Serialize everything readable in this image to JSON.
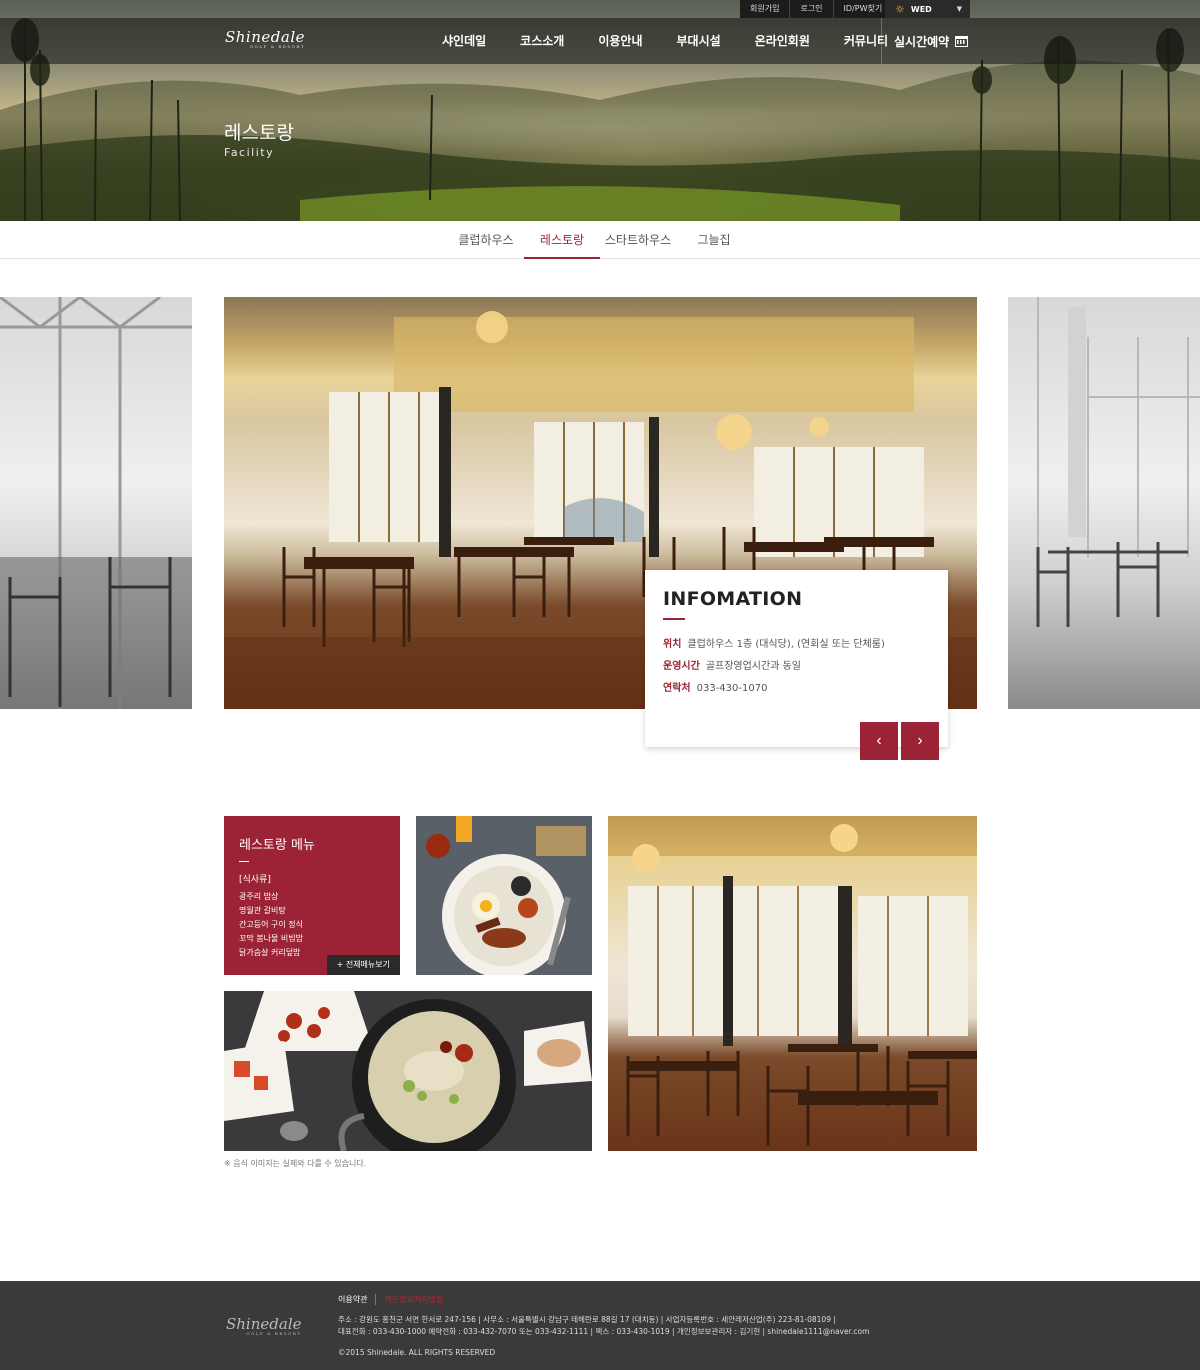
{
  "util_links": [
    "회원가입",
    "로그인",
    "ID/PW찾기"
  ],
  "weather": {
    "icon": "sun-icon",
    "day": "WED"
  },
  "brand": {
    "name": "Shinedale",
    "tagline": "GOLF & RESORT"
  },
  "nav": {
    "items": [
      "샤인데일",
      "코스소개",
      "이용안내",
      "부대시설",
      "온라인회원",
      "커뮤니티"
    ],
    "reserve": "실시간예약"
  },
  "hero": {
    "title": "레스토랑",
    "subtitle": "Facility"
  },
  "tabs": [
    {
      "label": "클럽하우스",
      "active": false
    },
    {
      "label": "레스토랑",
      "active": true
    },
    {
      "label": "스타트하우스",
      "active": false
    },
    {
      "label": "그늘집",
      "active": false
    }
  ],
  "info": {
    "title": "INFOMATION",
    "rows": [
      {
        "label": "위치",
        "value": "클럽하우스 1층 (대식당), (연회실 또는 단체룸)"
      },
      {
        "label": "운영시간",
        "value": "골프장영업시간과 동일"
      },
      {
        "label": "연락처",
        "value": "033-430-1070"
      }
    ],
    "prev": "‹",
    "next": "›"
  },
  "menu": {
    "title": "레스토랑 메뉴",
    "category": "[식사류]",
    "items": [
      "광주리 밥상",
      "명월관 갈비탕",
      "간고등어 구이 정식",
      "꼬막 봄나물 비빔밥",
      "닭가슴살 커리덮밥"
    ],
    "more": "+ 전체메뉴보기"
  },
  "note": "※ 음식 이미지는 실제와 다를 수 있습니다.",
  "footer": {
    "links": [
      "이용약관",
      "개인정보처리방침"
    ],
    "address_line1": "주소 : 강원도 홍천군 서면 한서로 247-156  |  사무소 : 서울특별시 강남구 테헤란로 88길 17 (대치동)  |  사업자등록번호 : 세안레저산업(주) 223-81-08109  |",
    "address_line2": "대표전화 : 033-430-1000 예약전화 : 033-432-7070 또는 033-432-1111  |  팩스 : 033-430-1019  |  개인정보보관리자 : 김기현  |  shinedale1111@naver.com",
    "copyright": "©2015 Shinedale. ALL RIGHTS RESERVED"
  },
  "colors": {
    "accent": "#9b2335",
    "footer_bg": "#3a3a3a"
  }
}
